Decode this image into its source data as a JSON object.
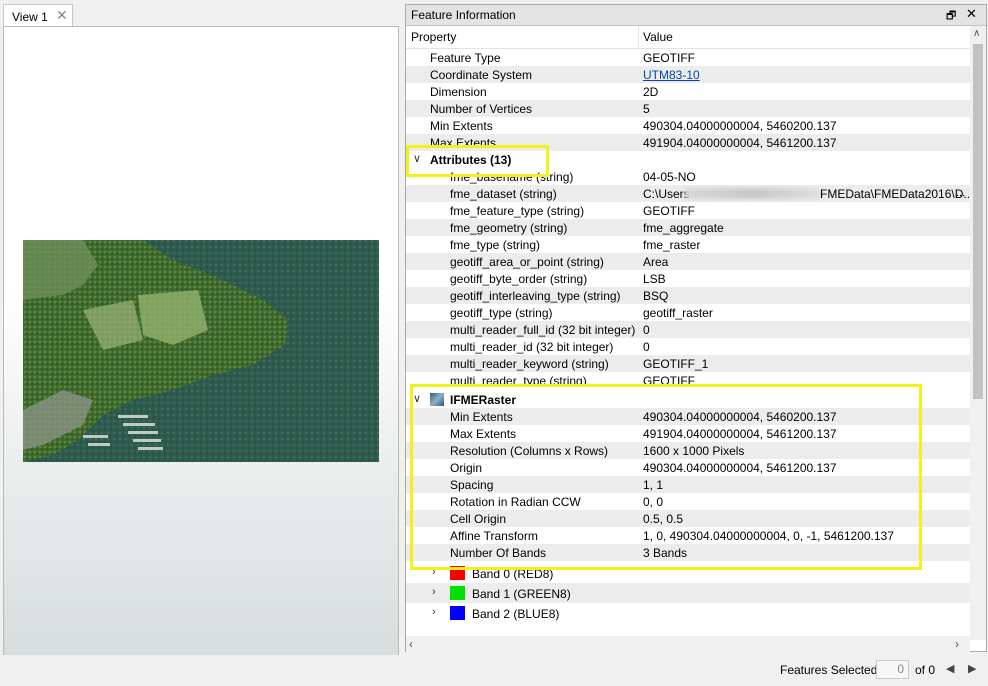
{
  "view": {
    "tab_label": "View 1",
    "close_glyph": "✕"
  },
  "panel": {
    "title": "Feature Information",
    "float_glyph": "🗗",
    "close_glyph": "✕",
    "header": {
      "property": "Property",
      "value": "Value"
    },
    "feature": [
      {
        "p": "Feature Type",
        "v": "GEOTIFF"
      },
      {
        "p": "Coordinate System",
        "v": "UTM83-10"
      },
      {
        "p": "Dimension",
        "v": "2D"
      },
      {
        "p": "Number of Vertices",
        "v": "5"
      },
      {
        "p": "Min Extents",
        "v": "490304.04000000004, 5460200.137"
      },
      {
        "p": "Max Extents",
        "v": "491904.04000000004, 5461200.137"
      }
    ],
    "attributes_label": "Attributes (13)",
    "attributes": [
      {
        "p": "fme_basename (string)",
        "v": "04-05-NO"
      },
      {
        "p": "fme_dataset (string)",
        "v": "C:\\Users",
        "v2": "FMEData\\FMEData2016\\D..."
      },
      {
        "p": "fme_feature_type (string)",
        "v": "GEOTIFF"
      },
      {
        "p": "fme_geometry (string)",
        "v": "fme_aggregate"
      },
      {
        "p": "fme_type (string)",
        "v": "fme_raster"
      },
      {
        "p": "geotiff_area_or_point (string)",
        "v": "Area"
      },
      {
        "p": "geotiff_byte_order (string)",
        "v": "LSB"
      },
      {
        "p": "geotiff_interleaving_type (string)",
        "v": "BSQ"
      },
      {
        "p": "geotiff_type (string)",
        "v": "geotiff_raster"
      },
      {
        "p": "multi_reader_full_id (32 bit integer)",
        "v": "0"
      },
      {
        "p": "multi_reader_id (32 bit integer)",
        "v": "0"
      },
      {
        "p": "multi_reader_keyword (string)",
        "v": "GEOTIFF_1"
      },
      {
        "p": "multi_reader_type (string)",
        "v": "GEOTIFF"
      }
    ],
    "raster_label": "IFMERaster",
    "raster": [
      {
        "p": "Min Extents",
        "v": "490304.04000000004, 5460200.137"
      },
      {
        "p": "Max Extents",
        "v": "491904.04000000004, 5461200.137"
      },
      {
        "p": "Resolution (Columns x Rows)",
        "v": "1600 x 1000 Pixels"
      },
      {
        "p": "Origin",
        "v": "490304.04000000004, 5461200.137"
      },
      {
        "p": "Spacing",
        "v": "1, 1"
      },
      {
        "p": "Rotation in Radian CCW",
        "v": "0, 0"
      },
      {
        "p": "Cell Origin",
        "v": "0.5, 0.5"
      },
      {
        "p": "Affine Transform",
        "v": "1, 0, 490304.04000000004, 0, -1, 5461200.137"
      },
      {
        "p": "Number Of Bands",
        "v": "3 Bands"
      }
    ],
    "bands": [
      {
        "p": "Band 0 (RED8)",
        "color": "#ff0000"
      },
      {
        "p": "Band 1 (GREEN8)",
        "color": "#00e000"
      },
      {
        "p": "Band 2 (BLUE8)",
        "color": "#0000ff"
      }
    ],
    "more_glyph": "..."
  },
  "status": {
    "features_selected_label": "Features Selected:",
    "selected_count": "0",
    "total": "of 0"
  },
  "colors": {
    "highlight": "#f2f21a",
    "link": "#0645ad"
  }
}
